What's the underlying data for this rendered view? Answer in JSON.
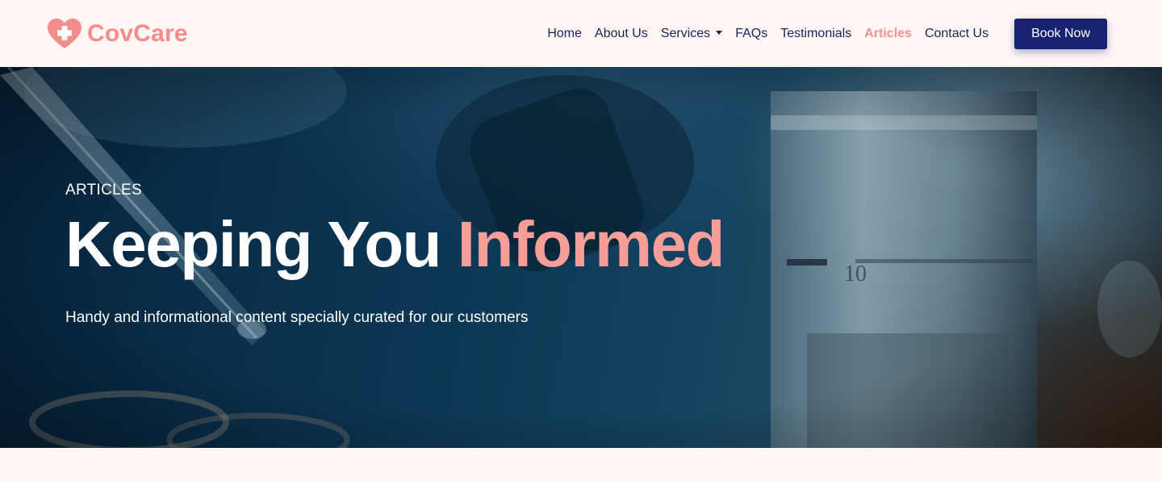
{
  "brand": {
    "name": "CovCare",
    "color": "#f68c89",
    "icon": "heart-plus-icon"
  },
  "nav": {
    "items": [
      {
        "label": "Home",
        "active": false
      },
      {
        "label": "About Us",
        "active": false
      },
      {
        "label": "Services",
        "active": false,
        "dropdown": true
      },
      {
        "label": "FAQs",
        "active": false
      },
      {
        "label": "Testimonials",
        "active": false
      },
      {
        "label": "Articles",
        "active": true
      },
      {
        "label": "Contact Us",
        "active": false
      }
    ],
    "cta_label": "Book Now",
    "text_color": "#17245b",
    "active_color": "#f4928e",
    "cta_color": "#172371"
  },
  "hero": {
    "eyebrow": "ARTICLES",
    "headline_main": "Keeping You",
    "headline_accent": "Informed",
    "subtitle": "Handy and informational content specially curated for our customers",
    "accent_color": "#f89e98",
    "background_image": "laboratory-microscope-photo",
    "lens_label": "10"
  },
  "colors": {
    "page_background": "#fff7f6"
  }
}
